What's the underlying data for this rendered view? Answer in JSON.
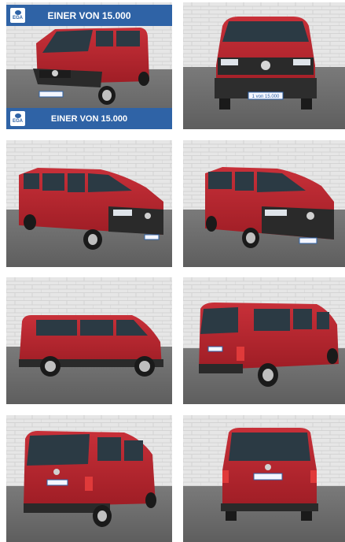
{
  "banner": {
    "top_text": "EINER VON 15.000",
    "bottom_text": "EINER VON 15.000",
    "logo_text": "EGA",
    "color": "#2f63a6"
  },
  "plate_text": "1 von 15.000",
  "colors": {
    "van_red": "#b8262e",
    "wall": "#e7e7e7",
    "floor": "#6d6d6d"
  },
  "gallery": [
    {
      "view": "front-left"
    },
    {
      "view": "front"
    },
    {
      "view": "front-right"
    },
    {
      "view": "front-right"
    },
    {
      "view": "side"
    },
    {
      "view": "rear-right"
    },
    {
      "view": "rear-left"
    },
    {
      "view": "rear"
    }
  ]
}
